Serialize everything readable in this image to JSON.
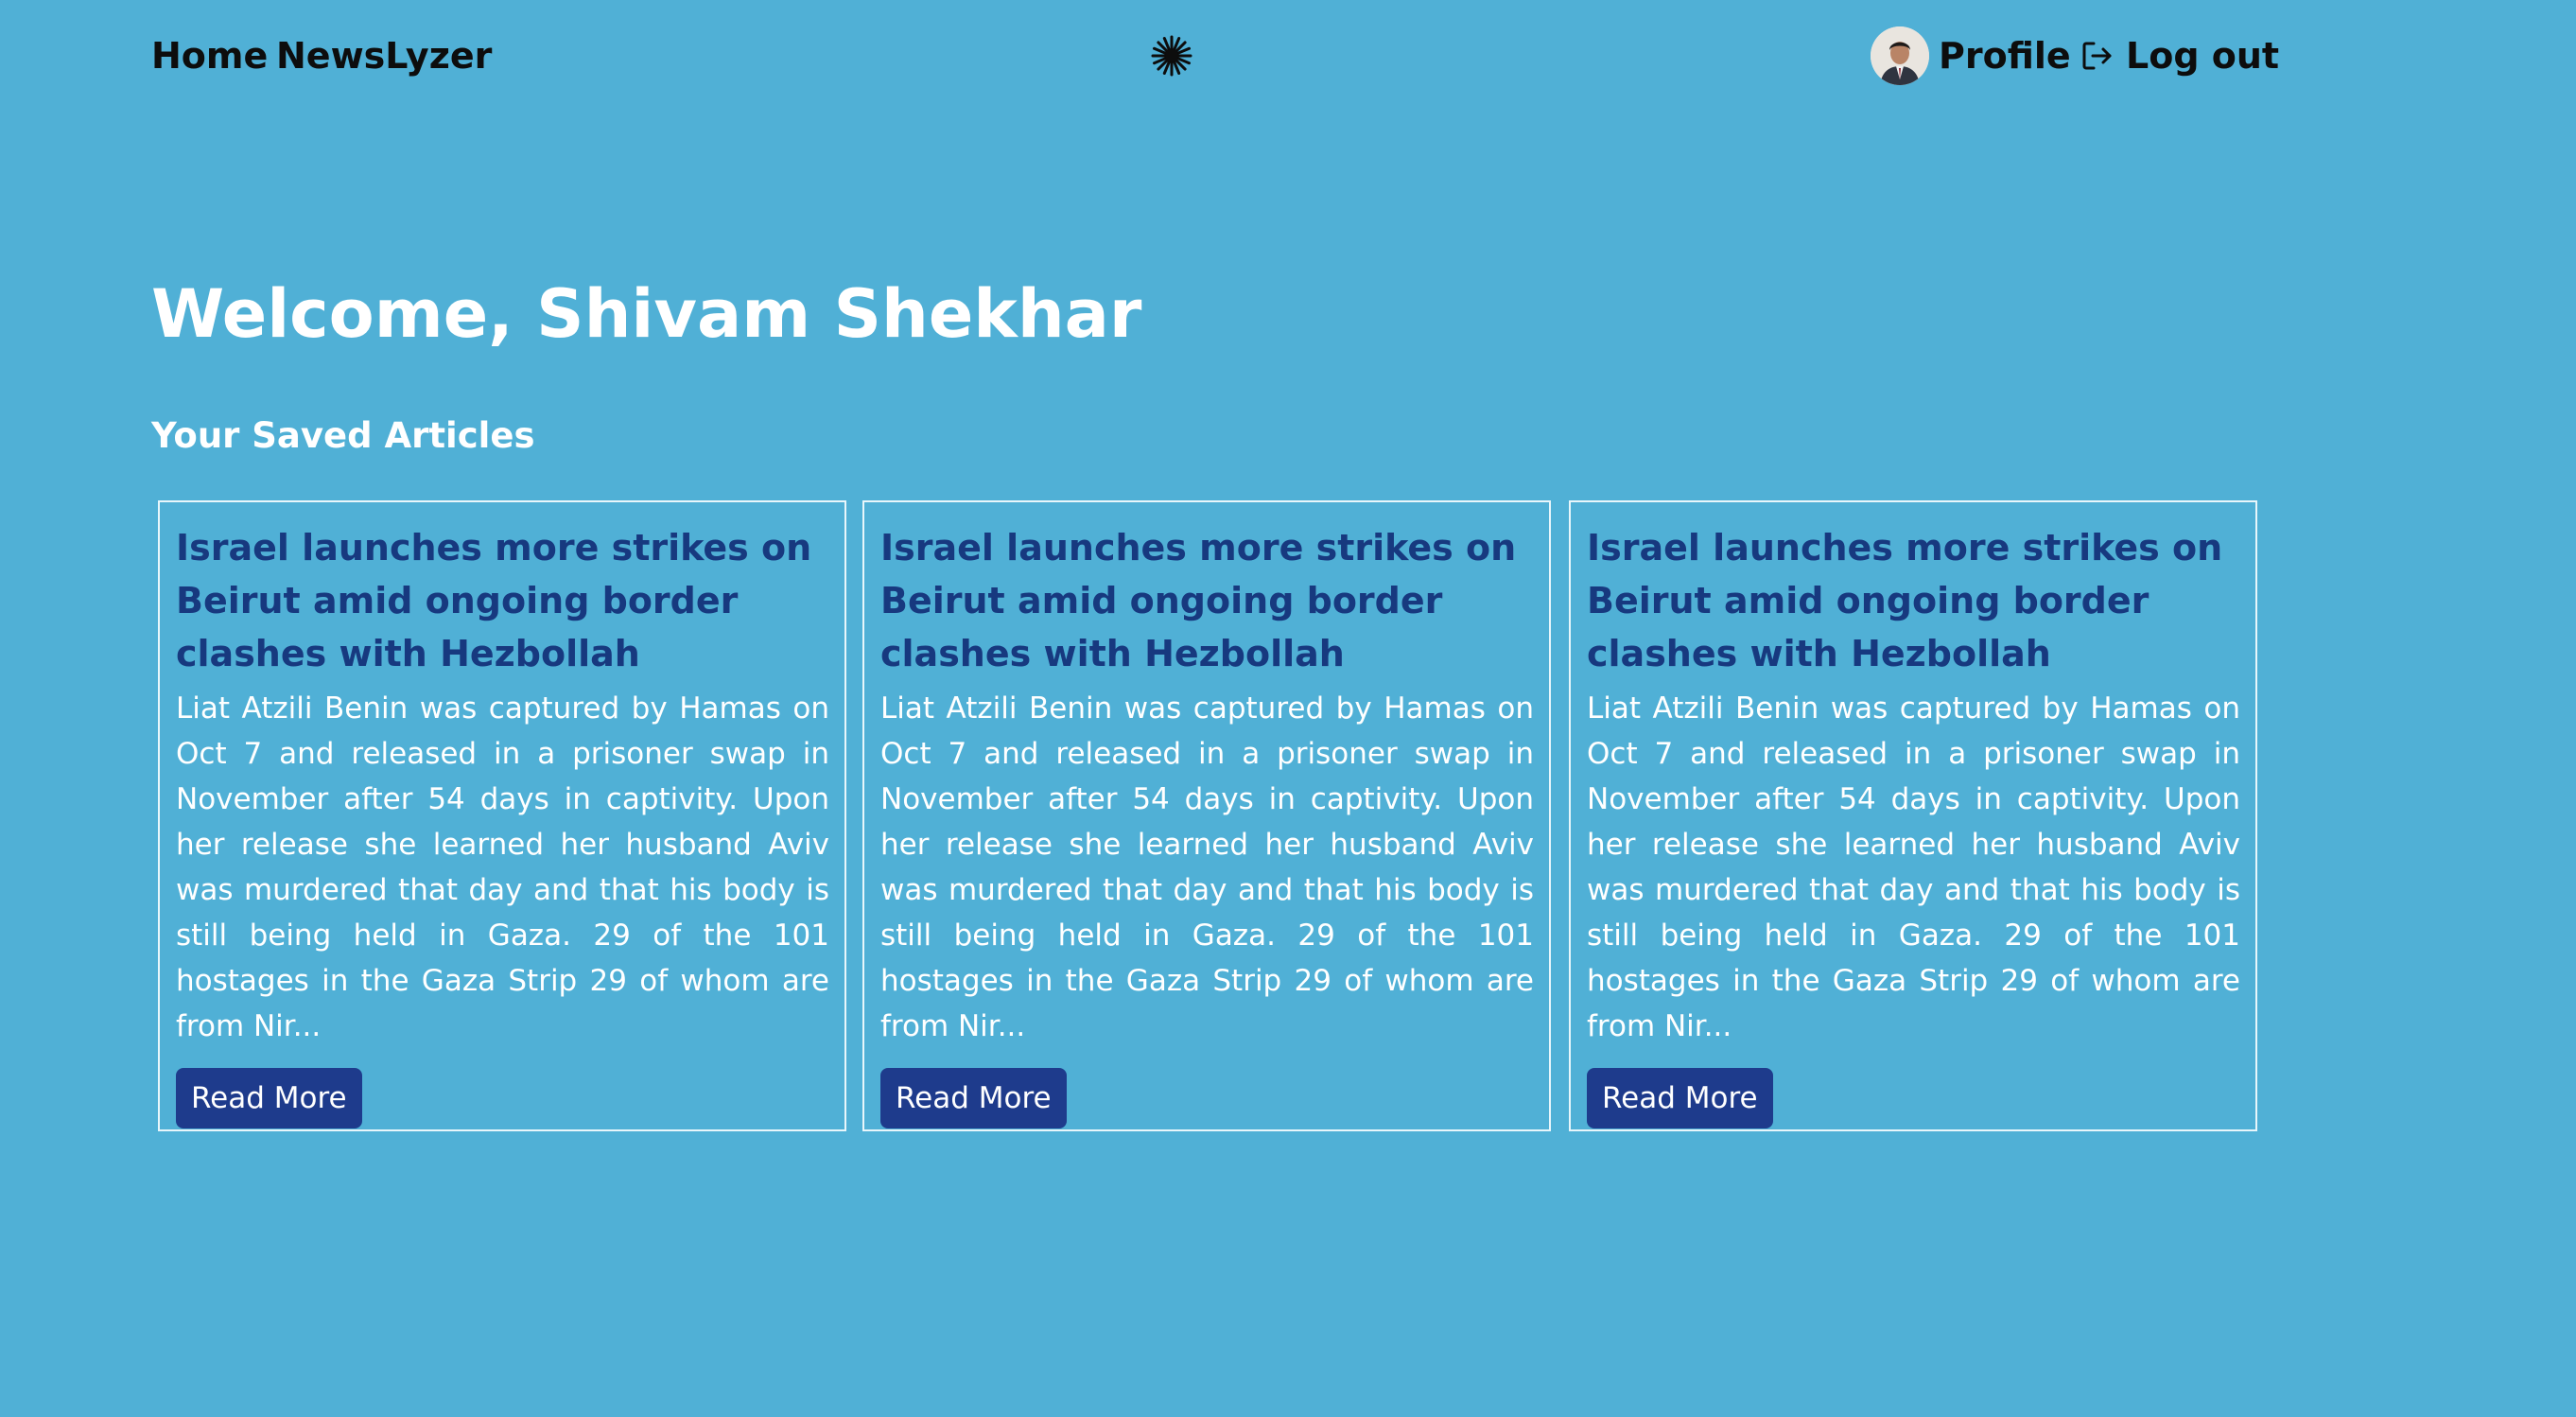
{
  "nav": {
    "home_label": "Home",
    "brand_label": "NewsLyzer",
    "logo_icon": "sunburst-icon",
    "profile_label": "Profile",
    "logout_label": "Log out",
    "logout_icon": "log-out-icon"
  },
  "welcome": {
    "heading": "Welcome, Shivam Shekhar"
  },
  "saved": {
    "section_title": "Your Saved Articles",
    "articles": [
      {
        "title": "Israel launches more strikes on Beirut amid ongoing border clashes with Hezbollah",
        "summary": "Liat Atzili Benin was captured by Hamas on Oct 7 and released in a prisoner swap in November after 54 days in captivity. Upon her release she learned her husband Aviv was murdered that day and that his body is still being held in Gaza. 29 of the 101 hostages in the Gaza Strip 29 of whom are from Nir...",
        "button_label": "Read More"
      },
      {
        "title": "Israel launches more strikes on Beirut amid ongoing border clashes with Hezbollah",
        "summary": "Liat Atzili Benin was captured by Hamas on Oct 7 and released in a prisoner swap in November after 54 days in captivity. Upon her release she learned her husband Aviv was murdered that day and that his body is still being held in Gaza. 29 of the 101 hostages in the Gaza Strip 29 of whom are from Nir...",
        "button_label": "Read More"
      },
      {
        "title": "Israel launches more strikes on Beirut amid ongoing border clashes with Hezbollah",
        "summary": "Liat Atzili Benin was captured by Hamas on Oct 7 and released in a prisoner swap in November after 54 days in captivity. Upon her release she learned her husband Aviv was murdered that day and that his body is still being held in Gaza. 29 of the 101 hostages in the Gaza Strip 29 of whom are from Nir...",
        "button_label": "Read More"
      }
    ]
  },
  "colors": {
    "background": "#50b0d6",
    "card_title": "#17397f",
    "button": "#1e3b8c",
    "text_light": "#ffffff",
    "nav_text": "#0d0d0d"
  }
}
